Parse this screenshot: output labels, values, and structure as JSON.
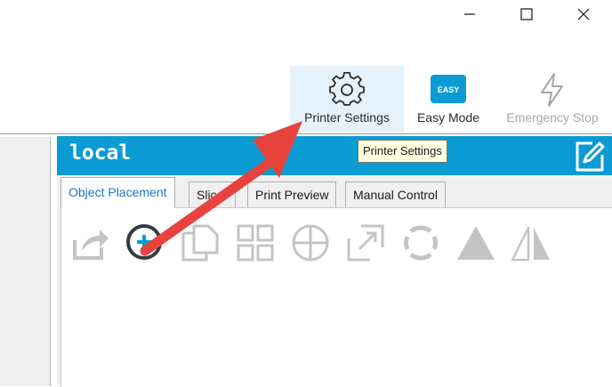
{
  "window": {
    "minimize_glyph": "—",
    "maximize_glyph": "☐",
    "close_glyph": "✕"
  },
  "toolbar": {
    "printer_settings_label": "Printer Settings",
    "easy_mode_label": "Easy Mode",
    "easy_badge": "EASY",
    "emergency_stop_label": "Emergency Stop"
  },
  "header": {
    "title": "local"
  },
  "tooltip": {
    "text": "Printer Settings"
  },
  "tabs": [
    {
      "label": "Object Placement",
      "active": true
    },
    {
      "label": "Slicer",
      "active": false
    },
    {
      "label": "Print Preview",
      "active": false
    },
    {
      "label": "Manual Control",
      "active": false
    }
  ],
  "tools": [
    "export-icon",
    "add-object-icon",
    "copy-icon",
    "grid-arrange-icon",
    "center-icon",
    "scale-icon",
    "rotate-icon",
    "cut-icon",
    "mirror-icon"
  ],
  "colors": {
    "header_blue": "#0b9bd3",
    "easy_badge": "#0b9bd3",
    "arrow_red": "#e8423c",
    "active_tab_text": "#1a76c7",
    "disabled_icon": "#c4c4c4"
  }
}
